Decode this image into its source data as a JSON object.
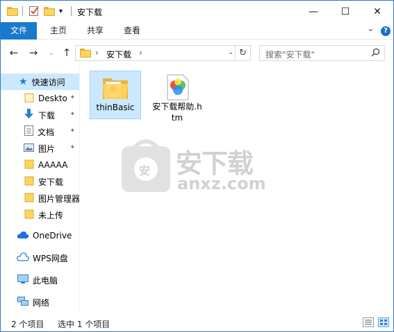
{
  "window": {
    "title": "安下载",
    "minimize_icon": "—",
    "maximize_icon": "☐",
    "close_icon": "✕",
    "customize_arrow": "▾"
  },
  "ribbon": {
    "tabs": [
      {
        "label": "文件"
      },
      {
        "label": "主页"
      },
      {
        "label": "共享"
      },
      {
        "label": "查看"
      }
    ],
    "expand_icon": "⌄",
    "help_icon": "?"
  },
  "nav": {
    "back": "←",
    "forward": "→",
    "recent": "⌄",
    "up": "↑",
    "address_path": "安下载",
    "address_chev": "›",
    "address_chev2": "›",
    "address_dropdown": "⌄",
    "refresh": "↻",
    "search_placeholder": "搜索\"安下载\"",
    "search_icon": "⚲"
  },
  "sidebar": {
    "quick_access": "快速访问",
    "items": [
      {
        "label": "Deskto",
        "icon": "folder-blue",
        "pinned": true
      },
      {
        "label": "下载",
        "icon": "download",
        "pinned": true
      },
      {
        "label": "文档",
        "icon": "document",
        "pinned": true
      },
      {
        "label": "图片",
        "icon": "picture",
        "pinned": true
      },
      {
        "label": "AAAAA",
        "icon": "folder",
        "pinned": false
      },
      {
        "label": "安下载",
        "icon": "folder",
        "pinned": false
      },
      {
        "label": "图片管理器",
        "icon": "folder",
        "pinned": false
      },
      {
        "label": "未上传",
        "icon": "folder",
        "pinned": false
      }
    ],
    "onedrive": "OneDrive",
    "wps": "WPS网盘",
    "thispc": "此电脑",
    "network": "网络",
    "pin_glyph": "📌"
  },
  "files": [
    {
      "name": "thinBasic",
      "type": "folder",
      "selected": true
    },
    {
      "name": "安下载帮助.htm",
      "type": "htm",
      "selected": false
    }
  ],
  "status": {
    "count": "2 个项目",
    "selected": "选中 1 个项目"
  },
  "watermark": {
    "text_cn": "安下载",
    "text_en": "anxz.com",
    "badge": "安"
  },
  "colors": {
    "accent": "#1979ca",
    "selection": "#cce8ff",
    "folder": "#ffd45c"
  }
}
